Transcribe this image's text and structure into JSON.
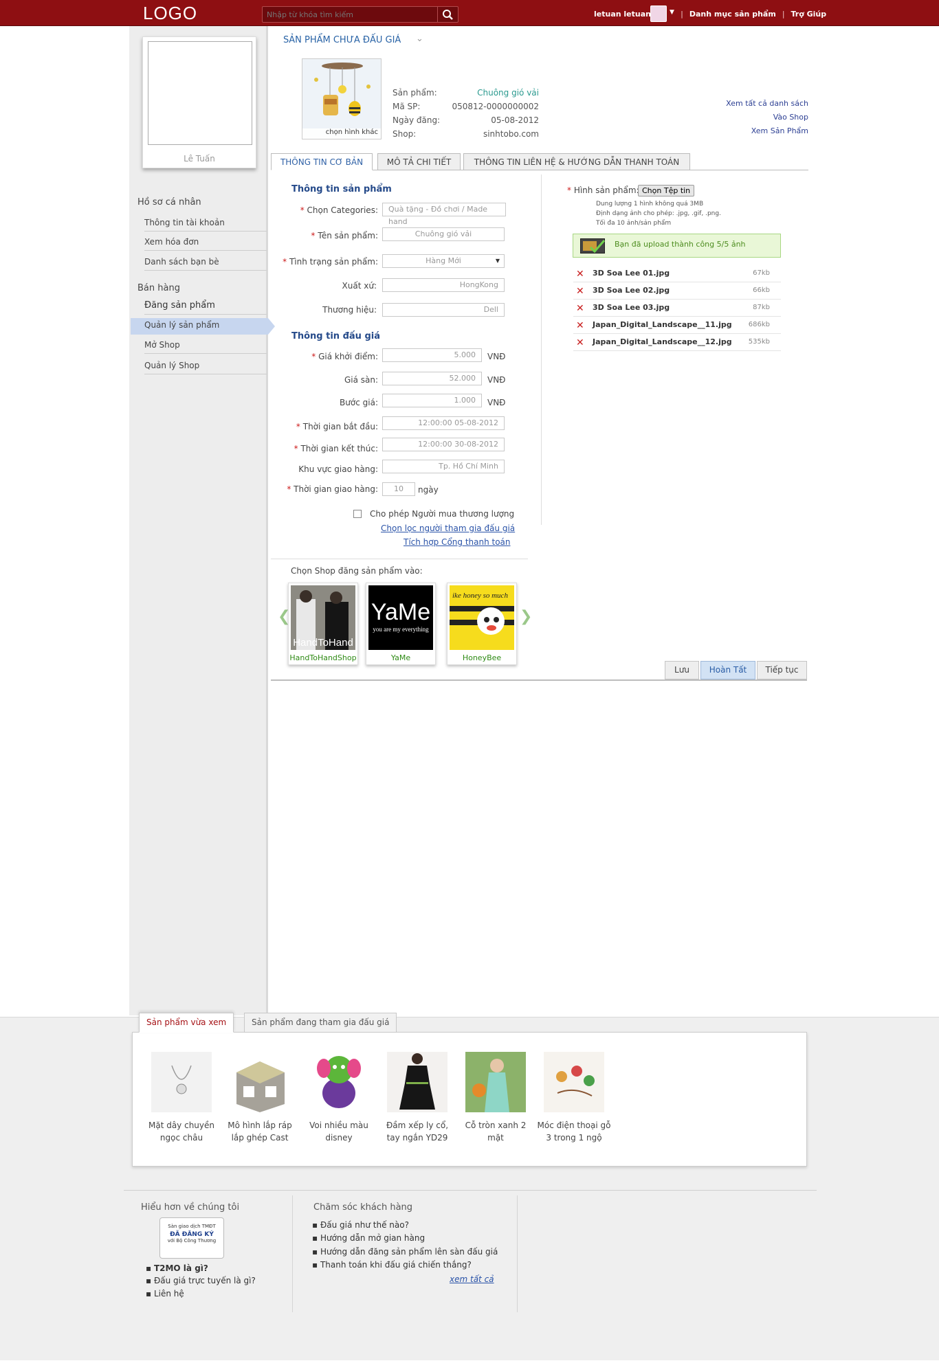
{
  "header": {
    "logo": "LOGO",
    "search_placeholder": "Nhập từ khóa tìm kiếm",
    "username": "letuan letuan...",
    "nav": [
      "Danh mục sản phẩm",
      "Trợ Giúp"
    ]
  },
  "profile": {
    "name": "Lê Tuấn"
  },
  "sidebar": {
    "section1": "Hồ sơ cá nhân",
    "items1": [
      "Thông tin tài khoản",
      "Xem hóa đơn",
      "Danh sách bạn bè"
    ],
    "section2": "Bán hàng",
    "items2": [
      "Đăng sản phẩm",
      "Quản lý sản phẩm",
      "Mở Shop",
      "Quản lý Shop"
    ]
  },
  "page": {
    "title": "SẢN PHẨM CHƯA ĐẤU GIÁ",
    "image_caption": "chọn hình khác",
    "info_labels": [
      "Sản phẩm:",
      "Mã SP:",
      "Ngày đăng:",
      "Shop:"
    ],
    "info_values": [
      "Chuông gió vải",
      "050812-0000000002",
      "05-08-2012",
      "sinhtobo.com"
    ],
    "right_links": [
      "Xem tất cả danh sách",
      "Vào Shop",
      "Xem Sản Phẩm"
    ]
  },
  "tabs": [
    "THÔNG TIN CƠ BẢN",
    "MÔ TẢ CHI TIẾT",
    "THÔNG TIN LIÊN HỆ & HƯỚNG DẪN THANH TOÁN"
  ],
  "form": {
    "section_product": "Thông tin sản phẩm",
    "category_label": "Chọn Categories:",
    "category_value": "Quà tặng - Đồ chơi / Made hand",
    "name_label": "Tên sản phẩm:",
    "name_value": "Chuông gió vải",
    "status_label": "Tình trạng sản phẩm:",
    "status_value": "Hàng Mới",
    "origin_label": "Xuất xứ:",
    "origin_value": "HongKong",
    "brand_label": "Thương hiệu:",
    "brand_value": "Dell",
    "section_auction": "Thông tin đấu giá",
    "start_price_label": "Giá khởi điểm:",
    "start_price_value": "5.000",
    "floor_price_label": "Giá sàn:",
    "floor_price_value": "52.000",
    "step_label": "Bước giá:",
    "step_value": "1.000",
    "currency": "VNĐ",
    "start_time_label": "Thời gian bắt đầu:",
    "start_time_value": "12:00:00 05-08-2012",
    "end_time_label": "Thời gian kết thúc:",
    "end_time_value": "12:00:00 30-08-2012",
    "region_label": "Khu vực giao hàng:",
    "region_value": "Tp. Hồ Chí Minh",
    "delivery_label": "Thời gian giao hàng:",
    "delivery_value": "10",
    "delivery_unit": "ngày",
    "negotiate_label": "Cho phép Người mua thương lượng",
    "filter_link": "Chọn lọc người tham gia đấu giá",
    "payment_link": "Tích hợp Cổng thanh toán"
  },
  "images": {
    "label": "Hình sản phẩm:",
    "button": "Chọn Tệp tin",
    "notes": [
      "Dung lượng 1 hình không quá 3MB",
      "Định dạng ảnh cho phép: .jpg, .gif, .png.",
      "Tối đa 10 ảnh/sản phẩm"
    ],
    "success": "Bạn đã upload thành công 5/5 ảnh",
    "files": [
      {
        "name": "3D Soa Lee 01.jpg",
        "size": "67kb"
      },
      {
        "name": "3D Soa Lee 02.jpg",
        "size": "66kb"
      },
      {
        "name": "3D Soa Lee 03.jpg",
        "size": "87kb"
      },
      {
        "name": "Japan_Digital_Landscape__11.jpg",
        "size": "686kb"
      },
      {
        "name": "Japan_Digital_Landscape__12.jpg",
        "size": "535kb"
      }
    ]
  },
  "shops": {
    "label": "Chọn Shop  đăng sản phẩm vào:",
    "items": [
      {
        "name": "HandToHandShop",
        "logo_text": "HandToHand"
      },
      {
        "name": "YaMe",
        "logo_text": "YaMe",
        "logo_sub": "you are my everything"
      },
      {
        "name": "HoneyBee",
        "logo_text": "ike honey so much"
      }
    ]
  },
  "buttons": [
    "Lưu",
    "Hoàn Tất",
    "Tiếp tục"
  ],
  "recent": {
    "tabs": [
      "Sản phẩm vừa xem",
      "Sản phẩm đang tham gia đấu giá"
    ],
    "items": [
      {
        "title": "Mặt dây chuyền ngọc châu"
      },
      {
        "title": "Mô hình lắp ráp lắp ghép Cast"
      },
      {
        "title": "Voi nhiều màu disney"
      },
      {
        "title": "Đầm xếp ly cổ, tay ngắn YD29"
      },
      {
        "title": "Cỗ tròn xanh 2 mặt"
      },
      {
        "title": "Móc điện thoại gỗ 3 trong 1 ngộ"
      }
    ]
  },
  "footer": {
    "about_title": "Hiểu hơn về chúng tôi",
    "badge": [
      "Sàn giao dịch TMĐT",
      "ĐÃ ĐĂNG KÝ",
      "với Bộ Công Thương"
    ],
    "about_links": [
      "T2MO là gì?",
      "Đấu giá trực tuyến là gì?",
      "Liên hệ"
    ],
    "care_title": "Chăm sóc khách hàng",
    "care_links": [
      "Đấu giá như thế nào?",
      "Hướng dẫn mở gian hàng",
      "Hướng dẫn đăng sản phẩm lên sàn đấu giá",
      "Thanh toán khi đấu giá chiến thắng?"
    ],
    "view_all": "xem tất cả"
  },
  "colors": {
    "header_bg": "#8e0f12",
    "link": "#2a53a8",
    "active_nav": "#c7d6ef"
  }
}
